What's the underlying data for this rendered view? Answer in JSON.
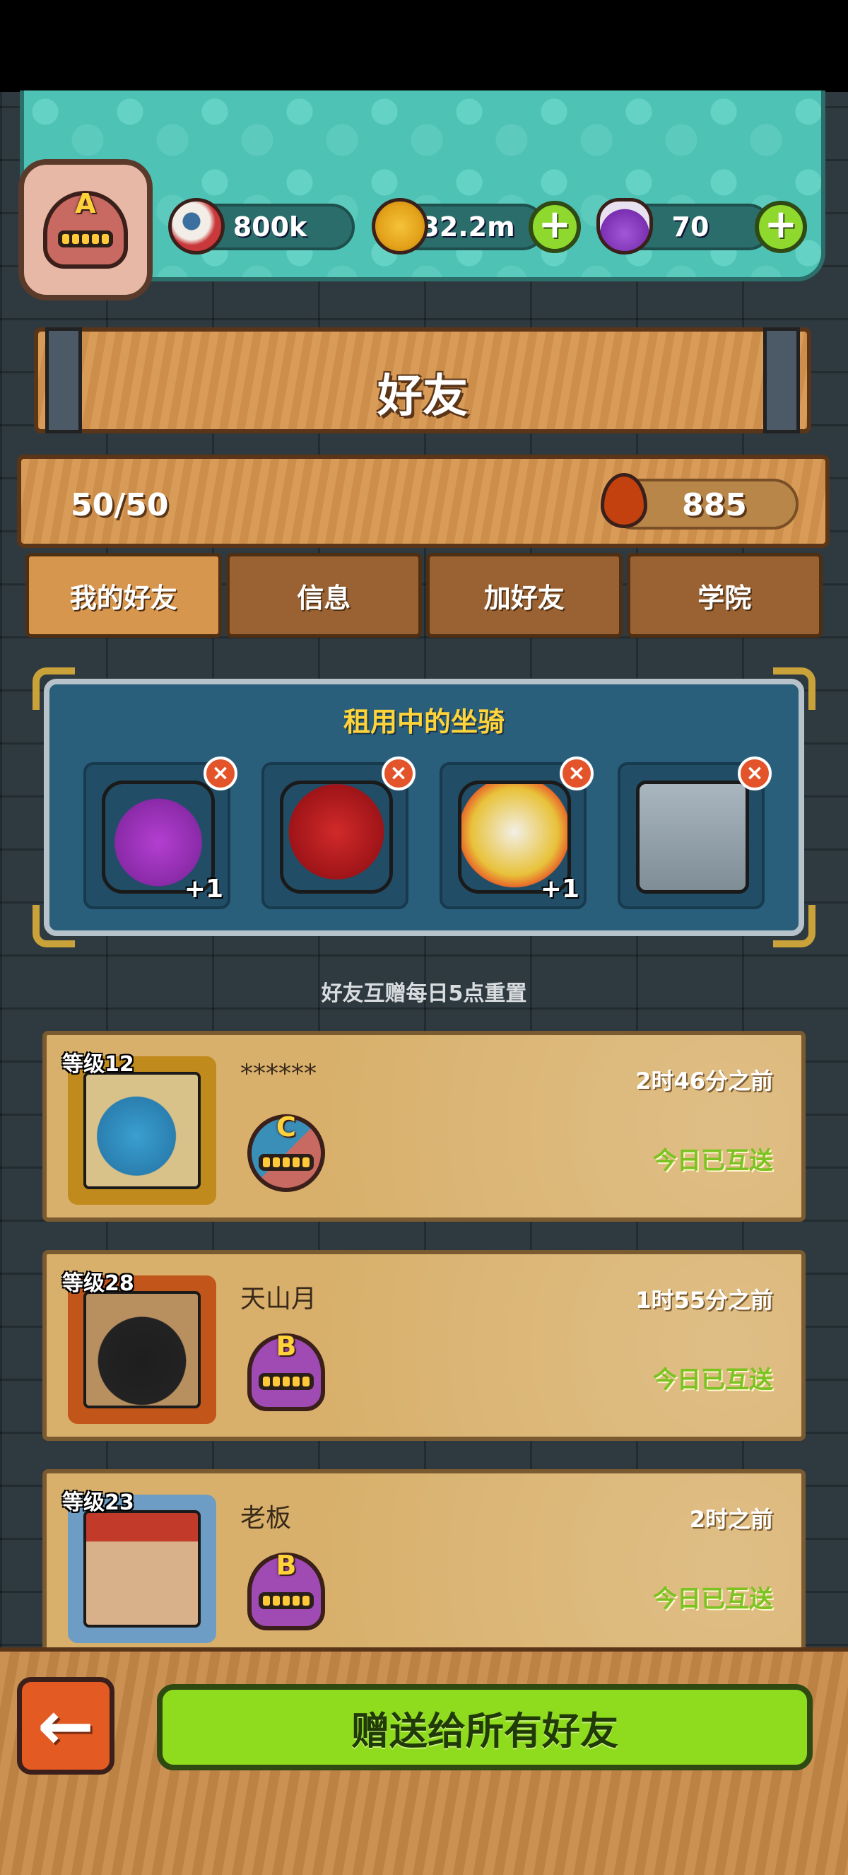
{
  "header": {
    "player_rank": "A",
    "resources": [
      {
        "name": "eyeball",
        "icon": "eyeball-icon",
        "value": "800k",
        "has_plus": false
      },
      {
        "name": "coins",
        "icon": "coin-icon",
        "value": "32.2m",
        "has_plus": true
      },
      {
        "name": "potion",
        "icon": "potion-icon",
        "value": "70",
        "has_plus": true
      }
    ]
  },
  "page_title": "好友",
  "friend_count": "50/50",
  "blood_value": "885",
  "tabs": [
    {
      "label": "我的好友",
      "active": true
    },
    {
      "label": "信息",
      "active": false
    },
    {
      "label": "加好友",
      "active": false
    },
    {
      "label": "学院",
      "active": false
    }
  ],
  "mounts": {
    "title": "租用中的坐骑",
    "items": [
      {
        "name": "purple horned monster",
        "bonus": "+1"
      },
      {
        "name": "red rose",
        "bonus": ""
      },
      {
        "name": "lion dance head",
        "bonus": "+1"
      },
      {
        "name": "stone machine",
        "bonus": ""
      }
    ]
  },
  "reset_note": "好友互赠每日5点重置",
  "friends": [
    {
      "level": "等级12",
      "name": "******",
      "last_seen": "2时46分之前",
      "gift_status": "今日已互送",
      "rank": "C"
    },
    {
      "level": "等级28",
      "name": "天山月",
      "last_seen": "1时55分之前",
      "gift_status": "今日已互送",
      "rank": "B"
    },
    {
      "level": "等级23",
      "name": "老板",
      "last_seen": "2时之前",
      "gift_status": "今日已互送",
      "rank": "B"
    }
  ],
  "bottom": {
    "back_icon": "arrow-left-icon",
    "gift_all_label": "赠送给所有好友"
  },
  "colors": {
    "teal": "#4ec2b5",
    "wood": "#d7964e",
    "green_button": "#8fdc1e",
    "gift_status": "#7ac320",
    "mount_title": "#ffd43a"
  }
}
